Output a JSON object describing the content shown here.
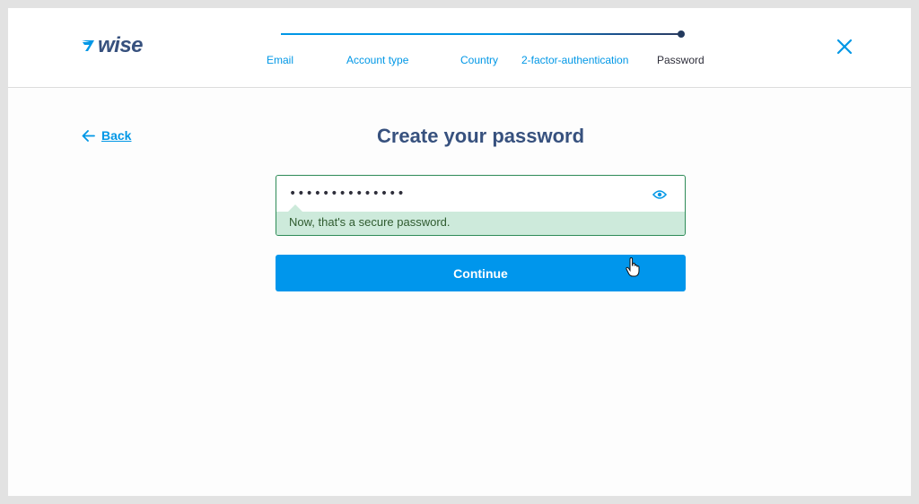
{
  "brand": {
    "name": "wise",
    "logo_icon": "wise-flag-icon",
    "accent": "#0097e6",
    "dark": "#37517e"
  },
  "stepper": {
    "steps": [
      {
        "label": "Email",
        "state": "done"
      },
      {
        "label": "Account type",
        "state": "done"
      },
      {
        "label": "Country",
        "state": "done"
      },
      {
        "label": "2-factor-authentication",
        "state": "done"
      },
      {
        "label": "Password",
        "state": "current"
      }
    ],
    "progress_fraction": 1.0
  },
  "header": {
    "close_icon": "close-icon"
  },
  "nav": {
    "back_label": "Back",
    "back_icon": "arrow-left-icon"
  },
  "page": {
    "title": "Create your password"
  },
  "password": {
    "value": "••••••••••••••",
    "toggle_icon": "eye-icon",
    "hint": "Now, that's a secure password.",
    "hint_color": "#cdeadb",
    "border_color": "#2e8b57"
  },
  "actions": {
    "continue_label": "Continue",
    "button_color": "#0096ec"
  }
}
